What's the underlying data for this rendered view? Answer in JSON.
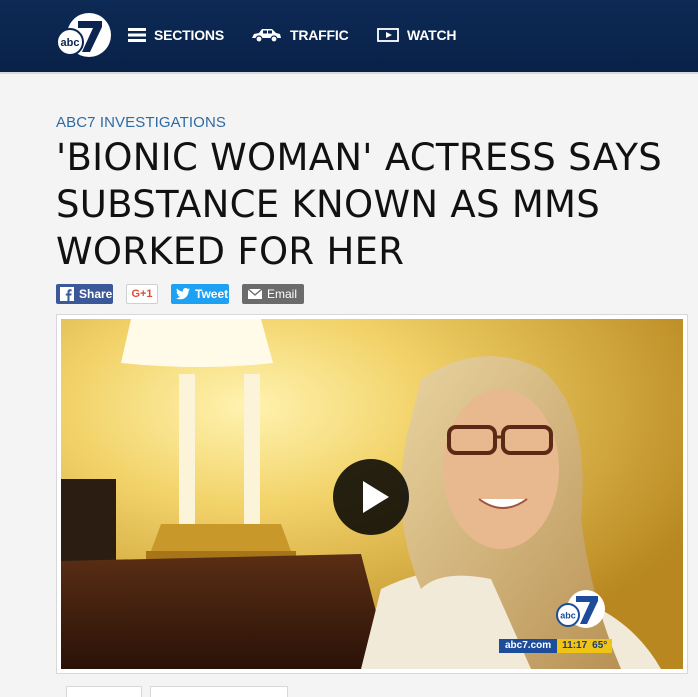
{
  "header": {
    "logo_text": "abc7",
    "nav": [
      {
        "label": "SECTIONS",
        "icon": "hamburger-icon"
      },
      {
        "label": "TRAFFIC",
        "icon": "car-icon"
      },
      {
        "label": "WATCH",
        "icon": "play-square-icon"
      }
    ]
  },
  "article": {
    "kicker": "ABC7 INVESTIGATIONS",
    "headline": "'BIONIC WOMAN' ACTRESS SAYS SUBSTANCE KNOWN AS MMS WORKED FOR HER",
    "share": {
      "facebook": "Share",
      "googleplus": "G+1",
      "twitter": "Tweet",
      "email": "Email"
    }
  },
  "video": {
    "bug_text": "abc7",
    "ticker_site": "abc7.com",
    "ticker_time": "11:17",
    "ticker_temp": "65°"
  },
  "colors": {
    "header_bg": "#0b2550",
    "kicker": "#2f6aa3",
    "facebook": "#3b5998",
    "twitter": "#1da1f2",
    "email": "#6b6b6b"
  }
}
